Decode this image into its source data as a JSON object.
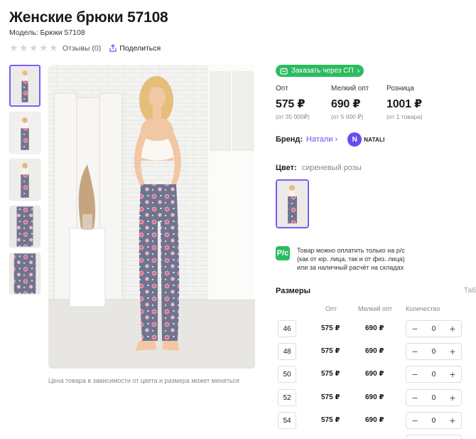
{
  "product": {
    "title": "Женские брюки 57108",
    "model": "Модель: Брюки 57108"
  },
  "meta": {
    "reviews": "Отзывы (0)",
    "share": "Поделиться"
  },
  "sp_button": "Заказать через СП",
  "prices": [
    {
      "label": "Опт",
      "value": "575 ₽",
      "note": "(от 35 000₽)"
    },
    {
      "label": "Мелкий опт",
      "value": "690 ₽",
      "note": "(от 5 000 ₽)"
    },
    {
      "label": "Розница",
      "value": "1001 ₽",
      "note": "(от 1 товара)"
    }
  ],
  "brand": {
    "label": "Бренд:",
    "name": "Натали",
    "logo_letter": "N",
    "logo_text": "NATALI"
  },
  "color": {
    "label": "Цвет:",
    "value": "сиреневый розы"
  },
  "payment_note": {
    "icon": "Р/с",
    "line1": "Товар можно оплатить только на р/с",
    "line2": "(как от юр. лица, так и от физ. лица)",
    "line3": "или за наличный расчёт на складах"
  },
  "sizes": {
    "title": "Размеры",
    "table_link": "Табл",
    "headers": {
      "opt": "Опт",
      "small_opt": "Мелкий опт",
      "qty": "Количество"
    },
    "rows": [
      {
        "size": "46",
        "opt": "575 ₽",
        "small": "690 ₽",
        "qty": "0"
      },
      {
        "size": "48",
        "opt": "575 ₽",
        "small": "690 ₽",
        "qty": "0"
      },
      {
        "size": "50",
        "opt": "575 ₽",
        "small": "690 ₽",
        "qty": "0"
      },
      {
        "size": "52",
        "opt": "575 ₽",
        "small": "690 ₽",
        "qty": "0"
      },
      {
        "size": "54",
        "opt": "575 ₽",
        "small": "690 ₽",
        "qty": "0"
      }
    ],
    "minus": "−",
    "plus": "+"
  },
  "caption": "Цена товара в зависимости от цвета и размера может меняться",
  "colors": {
    "accent": "#7b5cf5",
    "green": "#2dbb5f",
    "pants": "#6f7590",
    "flowers": "#e89aac"
  }
}
